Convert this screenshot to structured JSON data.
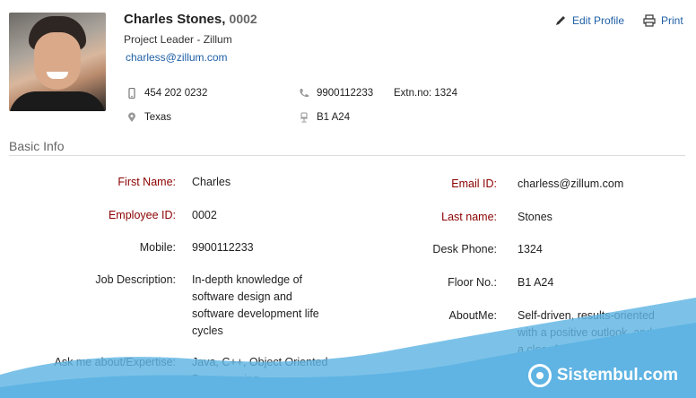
{
  "profile": {
    "name": "Charles Stones,",
    "employee_id": "0002",
    "role": "Project Leader - Zillum",
    "email": "charless@zillum.com"
  },
  "actions": {
    "edit_label": "Edit Profile",
    "print_label": "Print"
  },
  "contact": {
    "mobile": "454 202 0232",
    "phone": "9900112233",
    "extension": "Extn.no: 1324",
    "location": "Texas",
    "seat": "B1 A24"
  },
  "basic_info": {
    "title": "Basic Info",
    "left": [
      {
        "label": "First Name:",
        "value": "Charles"
      },
      {
        "label": "Employee ID:",
        "value": "0002"
      },
      {
        "label": "Mobile:",
        "value": "9900112233"
      },
      {
        "label": "Job Description:",
        "value": "In-depth knowledge of\nsoftware design and\nsoftware development life\ncycles"
      },
      {
        "label": "Ask me about/Expertise:",
        "value": "Java, C++, Object Oriented\nProgramming"
      }
    ],
    "right": [
      {
        "label": "Email ID:",
        "value": "charless@zillum.com"
      },
      {
        "label": "Last name:",
        "value": "Stones"
      },
      {
        "label": "Desk Phone:",
        "value": "1324"
      },
      {
        "label": "Floor No.:",
        "value": "B1 A24"
      },
      {
        "label": "AboutMe:",
        "value": "Self-driven, results-oriented\nwith a positive outlook, and\na clear focus on high quality\nand business profit."
      }
    ]
  },
  "watermark": {
    "text": "Sistembul.com"
  },
  "colors": {
    "link": "#1f5fa6",
    "required_label": "#8b0000",
    "wave": "#5fb4e3"
  },
  "icons": {
    "edit": "pencil-icon",
    "print": "printer-icon",
    "mobile": "mobile-phone-icon",
    "phone": "telephone-icon",
    "location": "location-pin-icon",
    "seat": "seat-icon"
  }
}
